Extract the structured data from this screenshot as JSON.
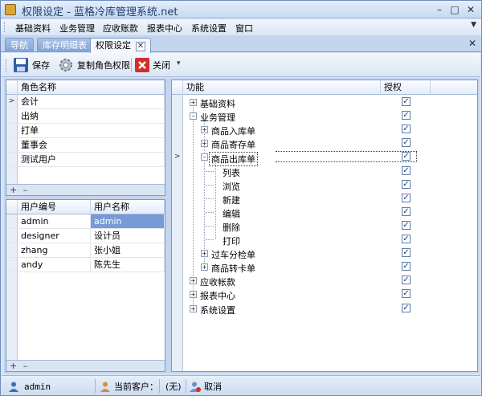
{
  "window": {
    "title": "权限设定 - 蓝格冷库管理系统.net",
    "minimize": "–",
    "maximize": "□",
    "close": "✕"
  },
  "menu": [
    "基础资料",
    "业务管理",
    "应收账款",
    "报表中心",
    "系统设置",
    "窗口"
  ],
  "tabs": [
    {
      "label": "导航",
      "active": false
    },
    {
      "label": "库存明细表",
      "active": false
    },
    {
      "label": "权限设定",
      "active": true
    }
  ],
  "toolbar": {
    "save": "保存",
    "copy_role": "复制角色权限",
    "close": "关闭"
  },
  "roles": {
    "column": "角色名称",
    "items": [
      "会计",
      "出纳",
      "打单",
      "董事会",
      "测试用户"
    ],
    "selected_index": 0
  },
  "users": {
    "columns": [
      "用户编号",
      "用户名称"
    ],
    "rows": [
      [
        "admin",
        "admin"
      ],
      [
        "designer",
        "设计员"
      ],
      [
        "zhang",
        "张小姐"
      ],
      [
        "andy",
        "陈先生"
      ]
    ],
    "selected_index": 0
  },
  "add_bar": {
    "add": "+",
    "remove": "–"
  },
  "permissions": {
    "columns": [
      "功能",
      "授权"
    ],
    "items": [
      {
        "label": "基础资料",
        "level": 0,
        "expander": "+",
        "checked": true
      },
      {
        "label": "业务管理",
        "level": 0,
        "expander": "–",
        "checked": true
      },
      {
        "label": "商品入库单",
        "level": 1,
        "expander": "+",
        "checked": true
      },
      {
        "label": "商品寄存单",
        "level": 1,
        "expander": "+",
        "checked": true
      },
      {
        "label": "商品出库单",
        "level": 1,
        "expander": "–",
        "checked": true,
        "focused": true
      },
      {
        "label": "列表",
        "level": 2,
        "expander": "",
        "checked": true
      },
      {
        "label": "浏览",
        "level": 2,
        "expander": "",
        "checked": true
      },
      {
        "label": "新建",
        "level": 2,
        "expander": "",
        "checked": true
      },
      {
        "label": "编辑",
        "level": 2,
        "expander": "",
        "checked": true
      },
      {
        "label": "删除",
        "level": 2,
        "expander": "",
        "checked": true
      },
      {
        "label": "打印",
        "level": 2,
        "expander": "",
        "checked": true
      },
      {
        "label": "过车分检单",
        "level": 1,
        "expander": "+",
        "checked": true
      },
      {
        "label": "商品转卡单",
        "level": 1,
        "expander": "+",
        "checked": true
      },
      {
        "label": "应收帐款",
        "level": 0,
        "expander": "+",
        "checked": true
      },
      {
        "label": "报表中心",
        "level": 0,
        "expander": "+",
        "checked": true
      },
      {
        "label": "系统设置",
        "level": 0,
        "expander": "+",
        "checked": true
      }
    ]
  },
  "status": {
    "user": "admin",
    "client_label": "当前客户：",
    "client_value": "(无)",
    "cancel": "取消"
  },
  "colors": {
    "selection": "#7a9ad6",
    "frame": "#c4d6ee"
  }
}
